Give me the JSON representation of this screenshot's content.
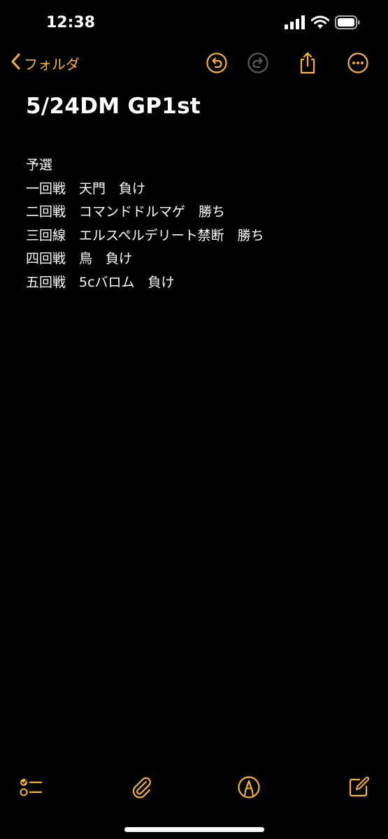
{
  "status_bar": {
    "time": "12:38",
    "icons": [
      "signal-icon",
      "wifi-icon",
      "battery-icon"
    ]
  },
  "nav": {
    "back_label": "フォルダ",
    "actions": [
      "undo-icon",
      "redo-icon",
      "share-icon",
      "more-icon"
    ],
    "accent_color": "#f5b42a"
  },
  "note": {
    "title": "5/24DM GP1st",
    "lines": [
      "予選",
      "一回戦　天門　負け",
      "二回戦　コマンドドルマゲ　勝ち",
      "三回線　エルスペルデリート禁断　勝ち",
      "四回戦　鳥　負け",
      "五回戦　5cバロム　負け"
    ]
  },
  "toolbar": {
    "actions": [
      "checklist-icon",
      "attachment-icon",
      "markup-icon",
      "compose-icon"
    ]
  }
}
